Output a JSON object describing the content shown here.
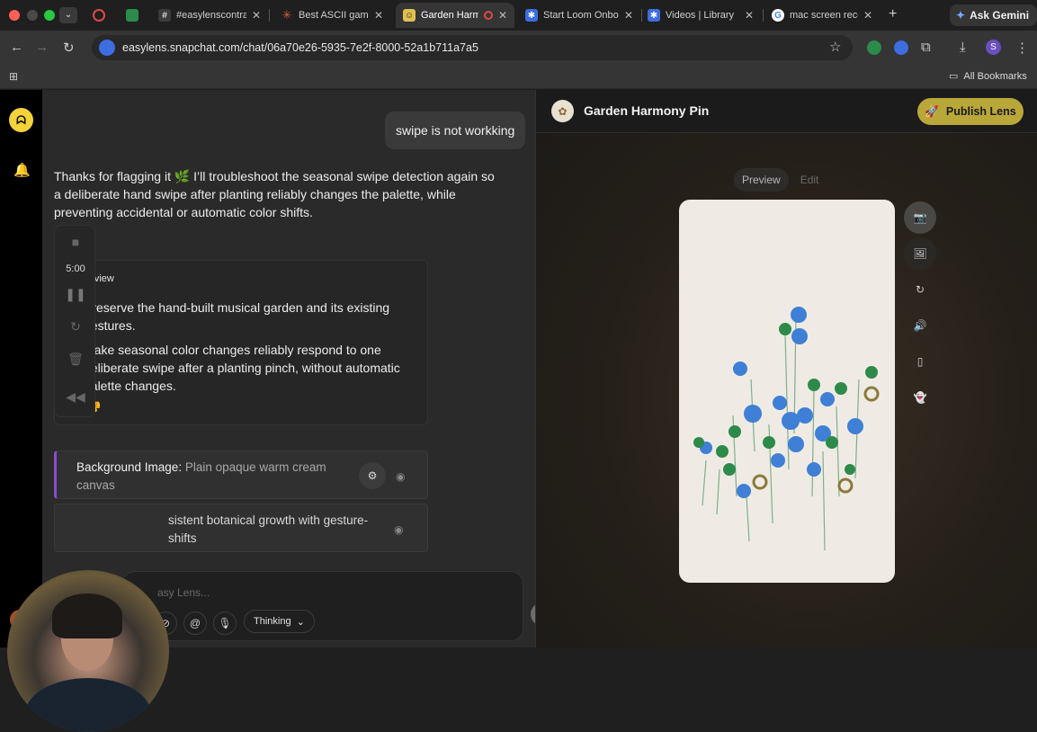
{
  "browser": {
    "tabs": [
      {
        "title": "#easylenscontra",
        "favicon_color": "#3b3b3b"
      },
      {
        "title": "Best ASCII game",
        "favicon_color": "#d35d3c"
      },
      {
        "title": "Garden Harm",
        "favicon_color": "#e0c050",
        "active": true
      },
      {
        "title": "Start Loom Onbo",
        "favicon_color": "#3d6de0"
      },
      {
        "title": "Videos | Library",
        "favicon_color": "#3d6de0"
      },
      {
        "title": "mac screen reco",
        "favicon_color": "#ffffff"
      }
    ],
    "ask_gemini": "Ask Gemini",
    "url": "easylens.snapchat.com/chat/06a70e26-5935-7e2f-8000-52a1b711a7a5",
    "profile_initial": "S",
    "all_bookmarks": "All Bookmarks"
  },
  "recorder": {
    "time": "5:00"
  },
  "chat": {
    "user_message": "swipe is not workking",
    "assistant_reply": "Thanks for flagging it 🌿 I’ll troubleshoot the seasonal swipe detection again so a deliberate hand swipe after planting reliably changes the palette, while preventing accidental or automatic color shifts.",
    "overview": {
      "heading": "Overview",
      "bullets": [
        "Preserve the hand-built musical garden and its existing gestures.",
        "Make seasonal color changes reliably respond to one deliberate swipe after a planting pinch, without automatic palette changes."
      ]
    },
    "params": [
      {
        "key": "Background Image:",
        "value": "Plain opaque warm cream canvas"
      },
      {
        "key": "",
        "value": "sistent botanical growth with gesture- shifts"
      }
    ],
    "composer": {
      "placeholder": "asy Lens...",
      "thinking_label": "Thinking"
    }
  },
  "preview": {
    "lens_name": "Garden Harmony Pin",
    "publish_label": "Publish Lens",
    "tabs": {
      "preview": "Preview",
      "edit": "Edit"
    },
    "accent": "#b9a73a"
  }
}
